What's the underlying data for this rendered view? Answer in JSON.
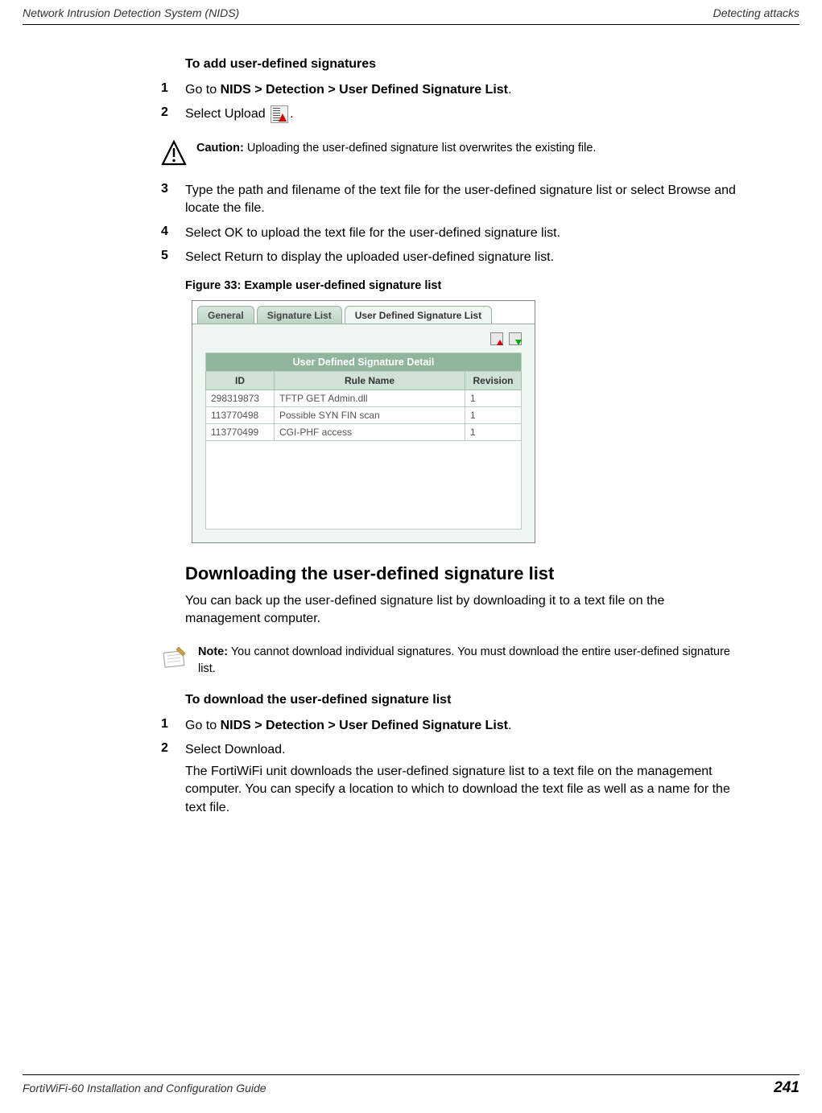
{
  "header": {
    "left": "Network Intrusion Detection System (NIDS)",
    "right": "Detecting attacks"
  },
  "sections": {
    "add_title": "To add user-defined signatures",
    "steps_a": [
      {
        "num": "1",
        "pre": "Go to ",
        "bold": "NIDS > Detection > User Defined Signature List",
        "post": "."
      },
      {
        "num": "2",
        "pre": "Select Upload ",
        "icon": true,
        "post": "."
      }
    ],
    "caution": {
      "label": "Caution:",
      "text": " Uploading the user-defined signature list overwrites the existing file."
    },
    "steps_b": [
      {
        "num": "3",
        "text": "Type the path and filename of the text file for the user-defined signature list or select Browse and locate the file."
      },
      {
        "num": "4",
        "text": "Select OK to upload the text file for the user-defined signature list."
      },
      {
        "num": "5",
        "text": "Select Return to display the uploaded user-defined signature list."
      }
    ],
    "figure_caption": "Figure 33: Example user-defined signature list",
    "download_heading": "Downloading the user-defined signature list",
    "download_intro": "You can back up the user-defined signature list by downloading it to a text file on the management computer.",
    "note": {
      "label": "Note:",
      "text": " You cannot download individual signatures. You must download the entire user-defined signature list."
    },
    "download_sub": "To download the user-defined signature list",
    "steps_c": [
      {
        "num": "1",
        "pre": "Go to ",
        "bold": "NIDS > Detection > User Defined Signature List",
        "post": "."
      },
      {
        "num": "2",
        "text": "Select Download.",
        "extra": "The FortiWiFi unit downloads the user-defined signature list to a text file on the management computer. You can specify a location to which to download the text file as well as a name for the text file."
      }
    ]
  },
  "screenshot": {
    "tabs": [
      "General",
      "Signature List",
      "User Defined Signature List"
    ],
    "active_tab": 2,
    "table_title": "User Defined Signature Detail",
    "columns": [
      "ID",
      "Rule Name",
      "Revision"
    ],
    "rows": [
      {
        "id": "298319873",
        "name": "TFTP GET Admin.dll",
        "rev": "1"
      },
      {
        "id": "113770498",
        "name": "Possible SYN FIN scan",
        "rev": "1"
      },
      {
        "id": "113770499",
        "name": "CGI-PHF access",
        "rev": "1"
      }
    ]
  },
  "footer": {
    "left": "FortiWiFi-60 Installation and Configuration Guide",
    "page": "241"
  }
}
